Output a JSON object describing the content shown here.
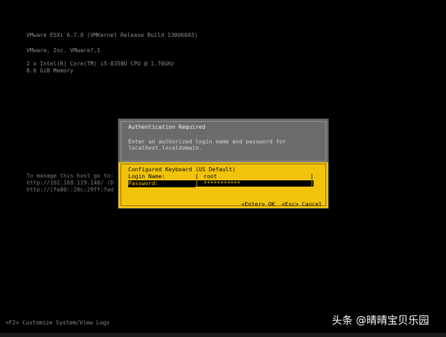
{
  "sysinfo": {
    "line1": "VMware ESXi 6.7.0 (VMKernel Release Build 13006603)",
    "line2": "VMware, Inc. VMware7,1",
    "line3": "2 x Intel(R) Core(TM) i5-8350U CPU @ 1.70GHz",
    "line4": "8.6 GiB Memory"
  },
  "manage": {
    "line1": "To manage this host go to:",
    "line2": "http://192.168.119.140/ (D",
    "line3": "http://[fe80::20c:29ff:fed"
  },
  "dialog": {
    "title": "Authentication Required",
    "message_line1": "Enter an authorized login name and password for",
    "message_line2": "localhost.localdomain.",
    "keyboard_label": "Configured Keyboard (US Default)",
    "login_label": "Login Name:",
    "login_value": "root",
    "password_label": "Password:",
    "password_value": "***********",
    "bracket_open": "[",
    "bracket_close": "]",
    "enter_action": "<Enter> OK",
    "esc_action": "<Esc> Cancel"
  },
  "footer": {
    "customize": "<F2> Customize System/View Logs"
  },
  "watermark": "头条 @晴晴宝贝乐园",
  "colors": {
    "background": "#000000",
    "dialog_header": "#6b6b6b",
    "dialog_body": "#f1c40b"
  }
}
